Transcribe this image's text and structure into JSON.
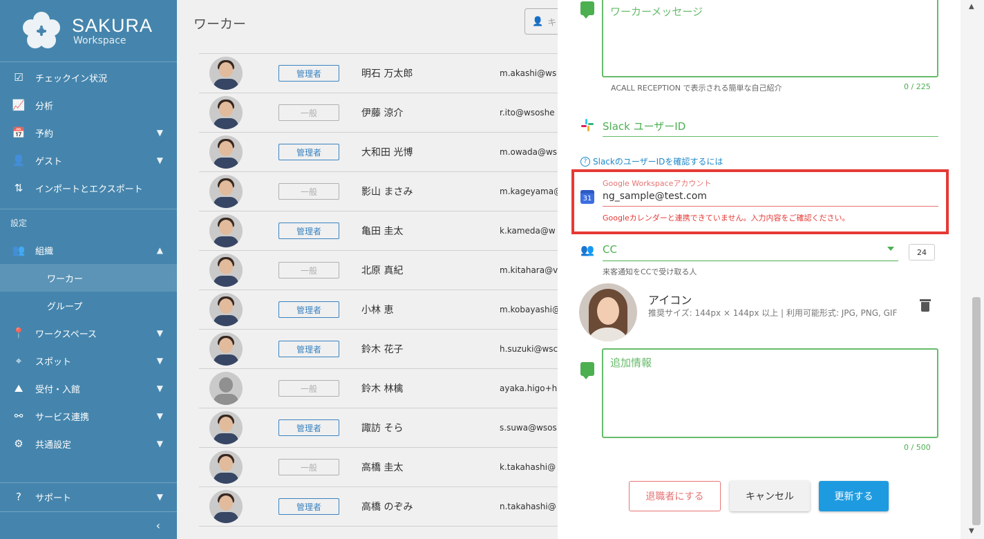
{
  "brand": {
    "title": "SAKURA",
    "subtitle": "Workspace"
  },
  "sidebar": {
    "items": [
      {
        "label": "チェックイン状況",
        "icon": "checkbox-icon"
      },
      {
        "label": "分析",
        "icon": "chart-icon"
      },
      {
        "label": "予約",
        "icon": "calendar-clock-icon",
        "expandable": true
      },
      {
        "label": "ゲスト",
        "icon": "guest-icon",
        "expandable": true
      },
      {
        "label": "インポートとエクスポート",
        "icon": "import-export-icon"
      }
    ],
    "section_label": "設定",
    "org": {
      "label": "組織",
      "icon": "people-icon"
    },
    "org_children": [
      "ワーカー",
      "グループ"
    ],
    "more_items": [
      {
        "label": "ワークスペース",
        "icon": "location-pin-icon"
      },
      {
        "label": "スポット",
        "icon": "spot-pin-icon"
      },
      {
        "label": "受付・入館",
        "icon": "reception-icon"
      },
      {
        "label": "サービス連携",
        "icon": "integration-icon"
      },
      {
        "label": "共通設定",
        "icon": "gear-icon"
      }
    ],
    "support": {
      "label": "サポート",
      "icon": "help-icon"
    }
  },
  "main": {
    "title": "ワーカー",
    "search_placeholder": "キ",
    "role_admin": "管理者",
    "role_general": "一般",
    "workers": [
      {
        "name": "明石 万太郎",
        "email": "m.akashi@ws",
        "role": "管理者"
      },
      {
        "name": "伊藤 涼介",
        "email": "r.ito@wsoshe",
        "role": "一般"
      },
      {
        "name": "大和田 光博",
        "email": "m.owada@ws",
        "role": "管理者"
      },
      {
        "name": "影山 まさみ",
        "email": "m.kageyama@",
        "role": "一般"
      },
      {
        "name": "亀田 圭太",
        "email": "k.kameda@w",
        "role": "管理者"
      },
      {
        "name": "北原 真紀",
        "email": "m.kitahara@v",
        "role": "一般"
      },
      {
        "name": "小林 恵",
        "email": "m.kobayashi@",
        "role": "管理者"
      },
      {
        "name": "鈴木 花子",
        "email": "h.suzuki@wsc",
        "role": "管理者"
      },
      {
        "name": "鈴木 林檎",
        "email": "ayaka.higo+h",
        "role": "一般"
      },
      {
        "name": "諏訪 そら",
        "email": "s.suwa@wsos",
        "role": "管理者"
      },
      {
        "name": "高橋 圭太",
        "email": "k.takahashi@",
        "role": "一般"
      },
      {
        "name": "高橋 のぞみ",
        "email": "n.takahashi@",
        "role": "管理者"
      }
    ]
  },
  "panel": {
    "message_placeholder": "ワーカーメッセージ",
    "message_hint": "ACALL RECEPTION で表示される簡単な自己紹介",
    "message_counter": "0 / 225",
    "slack_label": "Slack ユーザーID",
    "slack_link": "SlackのユーザーIDを確認するには",
    "google_label": "Google Workspaceアカウント",
    "google_value": "ng_sample@test.com",
    "google_error": "Googleカレンダーと連携できていません。入力内容をご確認ください。",
    "calendar_day": "31",
    "cc_label": "CC",
    "cc_count": "24",
    "cc_hint": "来客通知をCCで受け取る人",
    "icon_title": "アイコン",
    "icon_desc": "推奨サイズ: 144px × 144px 以上 | 利用可能形式: JPG, PNG, GIF",
    "extra_placeholder": "追加情報",
    "extra_counter": "0 / 500",
    "btn_retire": "退職者にする",
    "btn_cancel": "キャンセル",
    "btn_update": "更新する"
  },
  "colors": {
    "sidebar": "#1d6b9c",
    "accent_green": "#4caf50",
    "error_red": "#e53935",
    "primary_blue": "#1e9be0"
  }
}
